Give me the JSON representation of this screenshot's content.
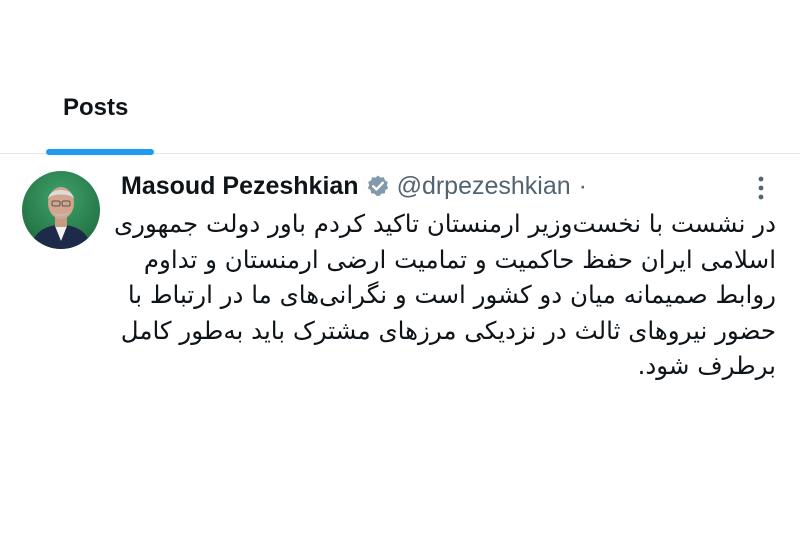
{
  "tabs": {
    "active_label": "Posts",
    "accent_color": "#1d9bf0"
  },
  "tweet": {
    "author_name": "Masoud Pezeshkian",
    "handle": "@drpezeshkian",
    "separator": "·",
    "verified_icon": "verified-badge-icon",
    "more_icon": "more-vertical-icon",
    "text_lines": [
      "در نشست با نخست‌وزیر ارمنستان تاکید کردم باور دولت جمهوری",
      "اسلامی ایران حفظ حاکمیت و تمامیت ارضی ارمنستان و تداوم",
      "روابط صمیمانه میان دو کشور است و نگرانی‌های ما در ارتباط با",
      "حضور نیروهای ثالث در نزدیکی مرزهای مشترک باید به‌طور کامل",
      "برطرف شود."
    ]
  }
}
